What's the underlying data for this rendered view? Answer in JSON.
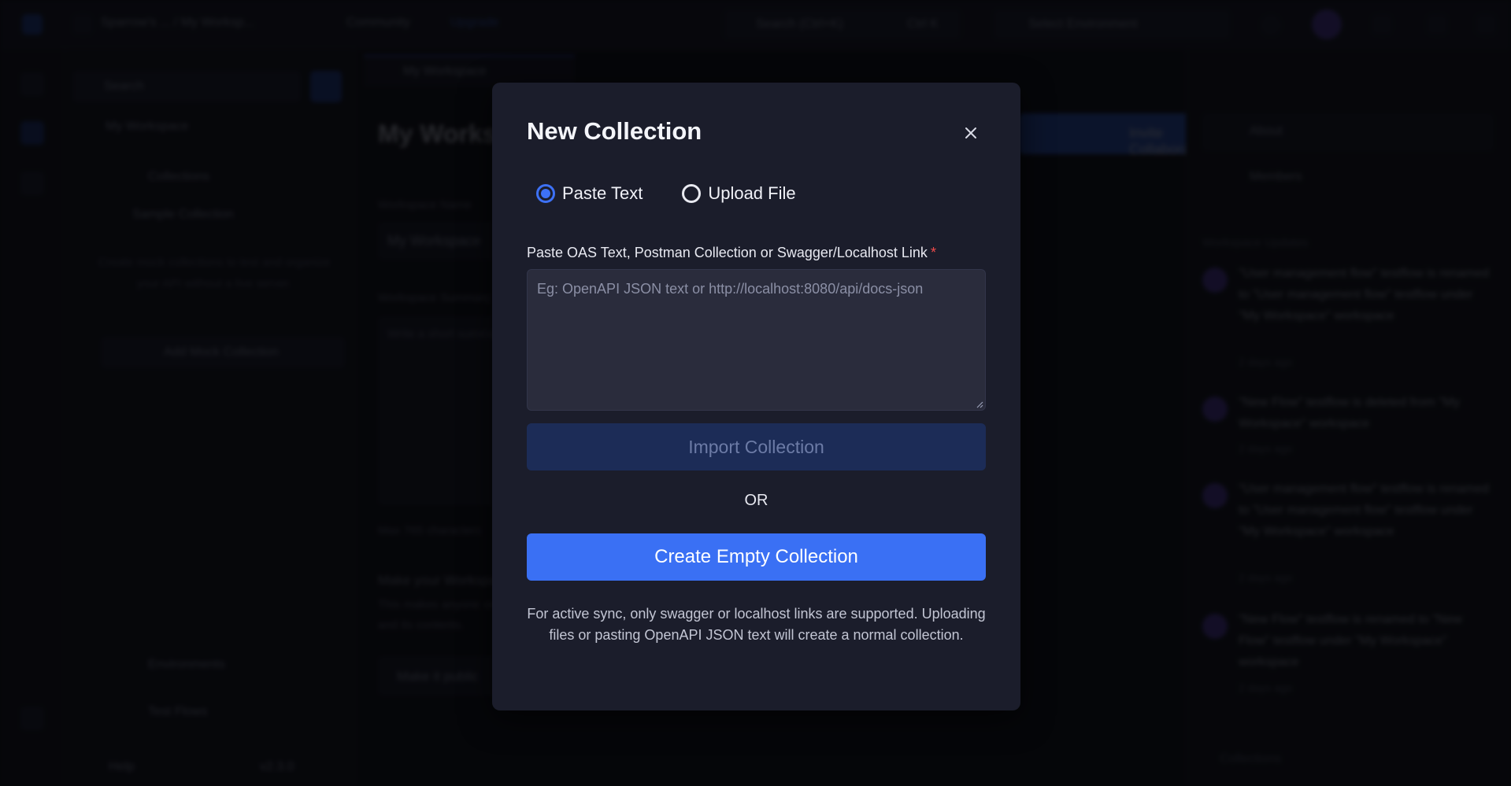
{
  "background": {
    "topbar": {
      "breadcrumb": "Sparrow's ... / My Worksp...",
      "community": "Community",
      "upgrade": "Upgrade",
      "search_placeholder": "Search (Ctrl+K)",
      "shortcut": "Ctrl K",
      "environment": "Select Environment"
    },
    "sidebar": {
      "search_placeholder": "Search",
      "workspace": "My Workspace",
      "collections": "Collections",
      "sample_collection": "Sample Collection",
      "mock_hint": "Create mock collections to test and organize your API without a live server.",
      "add_mock": "Add Mock Collection",
      "environments": "Environments",
      "test_flows": "Test Flows",
      "footer_label": "Help",
      "version": "v2.3.0"
    },
    "main": {
      "tab_label": "My Workspace",
      "title": "My Workspace",
      "name_label": "Workspace Name",
      "name_value": "My Workspace",
      "summary_label": "Workspace Summary",
      "summary_placeholder": "Write a short summary",
      "max_chars": "Max 765 characters",
      "public_title": "Make your Workspace public",
      "public_desc": "This makes anyone on the web see your workspace and its contents.",
      "public_button": "Make it public",
      "invite_button": "Invite Collaborators"
    },
    "rightpane": {
      "about": "About",
      "members": "Members",
      "updates_title": "Workspace Updates",
      "activities": [
        {
          "text": "\"User management flow\" testflow is renamed to \"User management flow\" testflow under \"My Workspace\" workspace",
          "time": "2 days ago"
        },
        {
          "text": "\"New Flow\" testflow is deleted from \"My Workspace\" workspace",
          "time": "2 days ago"
        },
        {
          "text": "\"User management flow\" testflow is renamed to \"User management flow\" testflow under \"My Workspace\" workspace",
          "time": "2 days ago"
        },
        {
          "text": "\"New Flow\" testflow is renamed to \"New Flow\" testflow under \"My Workspace\" workspace",
          "time": "2 days ago"
        }
      ],
      "footer": "Collections"
    }
  },
  "modal": {
    "title": "New Collection",
    "close_icon": "close-icon",
    "options": [
      {
        "label": "Paste Text",
        "checked": true
      },
      {
        "label": "Upload File",
        "checked": false
      }
    ],
    "field_label": "Paste OAS Text, Postman Collection or Swagger/Localhost Link",
    "required_mark": "*",
    "textarea_value": "",
    "textarea_placeholder": "Eg: OpenAPI JSON text or http://localhost:8080/api/docs-json",
    "import_label": "Import Collection",
    "or_text": "OR",
    "create_label": "Create Empty Collection",
    "note": "For active sync, only swagger or localhost links are supported. Uploading files or pasting OpenAPI JSON text will create a normal collection.",
    "colors": {
      "accent": "#3a70f4",
      "disabled_button": "#1c2c57",
      "required": "#f14b4b",
      "modal_bg": "#1b1d2b"
    }
  }
}
